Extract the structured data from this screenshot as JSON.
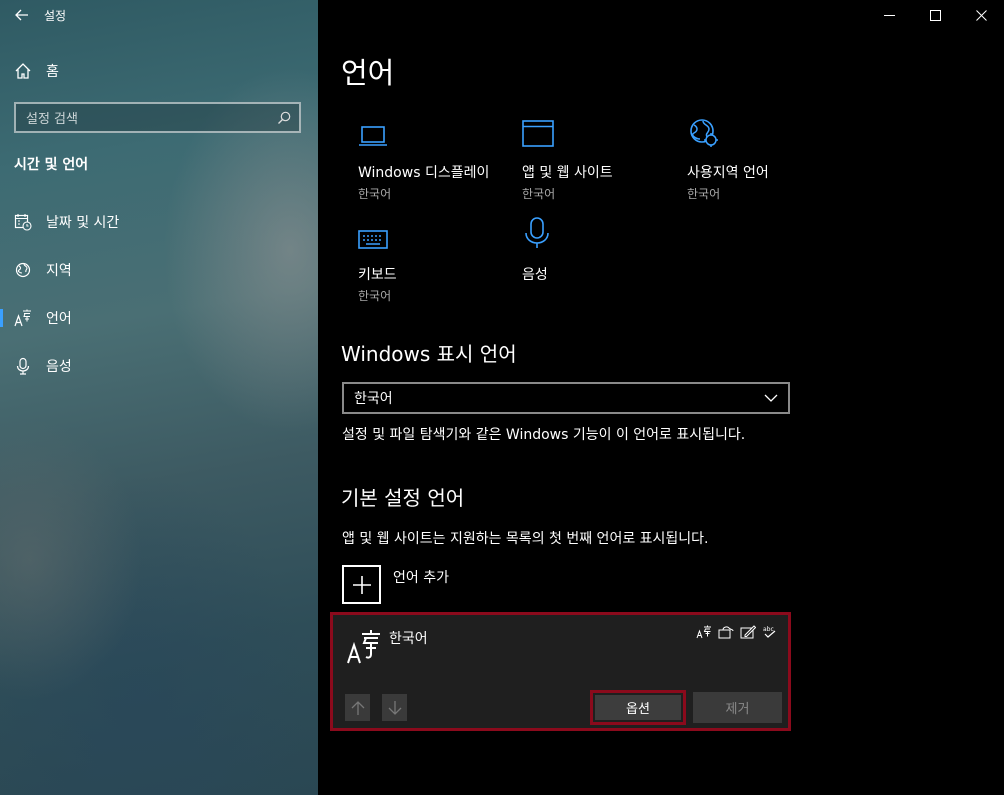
{
  "window": {
    "title": "설정",
    "controls": [
      "minimize",
      "maximize",
      "close"
    ]
  },
  "sidebar": {
    "home_label": "홈",
    "search_placeholder": "설정 검색",
    "section_title": "시간 및 언어",
    "items": [
      {
        "label": "날짜 및 시간",
        "icon": "calendar-clock-icon",
        "active": false
      },
      {
        "label": "지역",
        "icon": "globe-region-icon",
        "active": false
      },
      {
        "label": "언어",
        "icon": "language-icon",
        "active": true
      },
      {
        "label": "음성",
        "icon": "microphone-icon",
        "active": false
      }
    ]
  },
  "main": {
    "title": "언어",
    "accent_color": "#3aa0ff",
    "tiles": [
      {
        "label": "Windows 디스플레이",
        "sub": "한국어",
        "icon": "laptop-icon"
      },
      {
        "label": "앱 및 웹 사이트",
        "sub": "한국어",
        "icon": "browser-window-icon"
      },
      {
        "label": "사용지역 언어",
        "sub": "한국어",
        "icon": "globe-settings-icon"
      },
      {
        "label": "키보드",
        "sub": "한국어",
        "icon": "keyboard-icon"
      },
      {
        "label": "음성",
        "sub": "",
        "icon": "microphone-icon"
      }
    ],
    "display_language": {
      "heading": "Windows 표시 언어",
      "selected": "한국어",
      "description": "설정 및 파일 탐색기와 같은 Windows 기능이 이 언어로 표시됩니다."
    },
    "preferred_languages": {
      "heading": "기본 설정 언어",
      "description": "앱 및 웹 사이트는 지원하는 목록의 첫 번째 언어로 표시됩니다.",
      "add_label": "언어 추가",
      "languages": [
        {
          "name": "한국어",
          "feature_icons": [
            "display-language-icon",
            "speech-icon",
            "handwriting-icon",
            "spellcheck-icon"
          ],
          "options_label": "옵션",
          "remove_label": "제거"
        }
      ]
    },
    "highlight_color": "#8b0a1c"
  }
}
